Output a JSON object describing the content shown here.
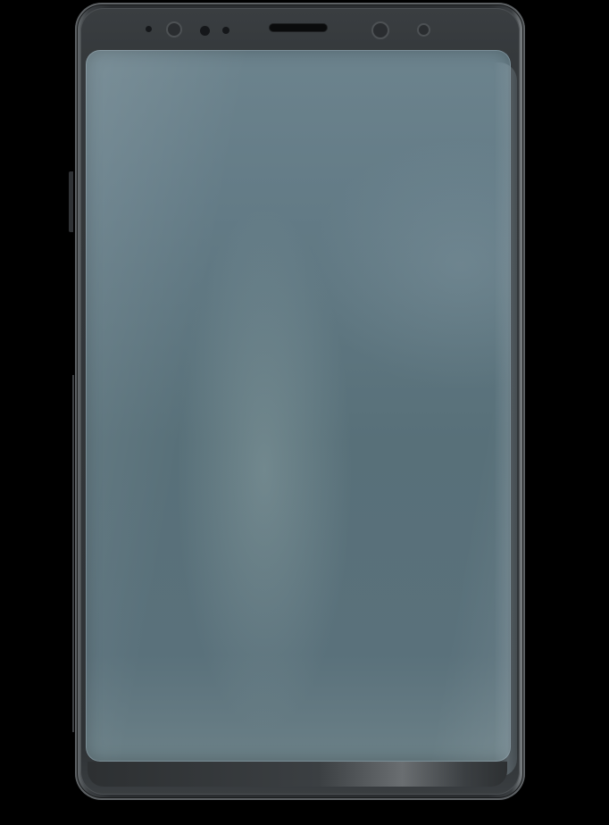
{
  "scene": {
    "subject": "smartphone-front-blank-screen",
    "colors": {
      "background": "#000000",
      "frame": "#2a2d30",
      "screen": "#5f7780"
    },
    "icons": [
      "earpiece-icon",
      "front-camera-icon",
      "proximity-sensor-icon",
      "iris-scanner-icon"
    ]
  }
}
